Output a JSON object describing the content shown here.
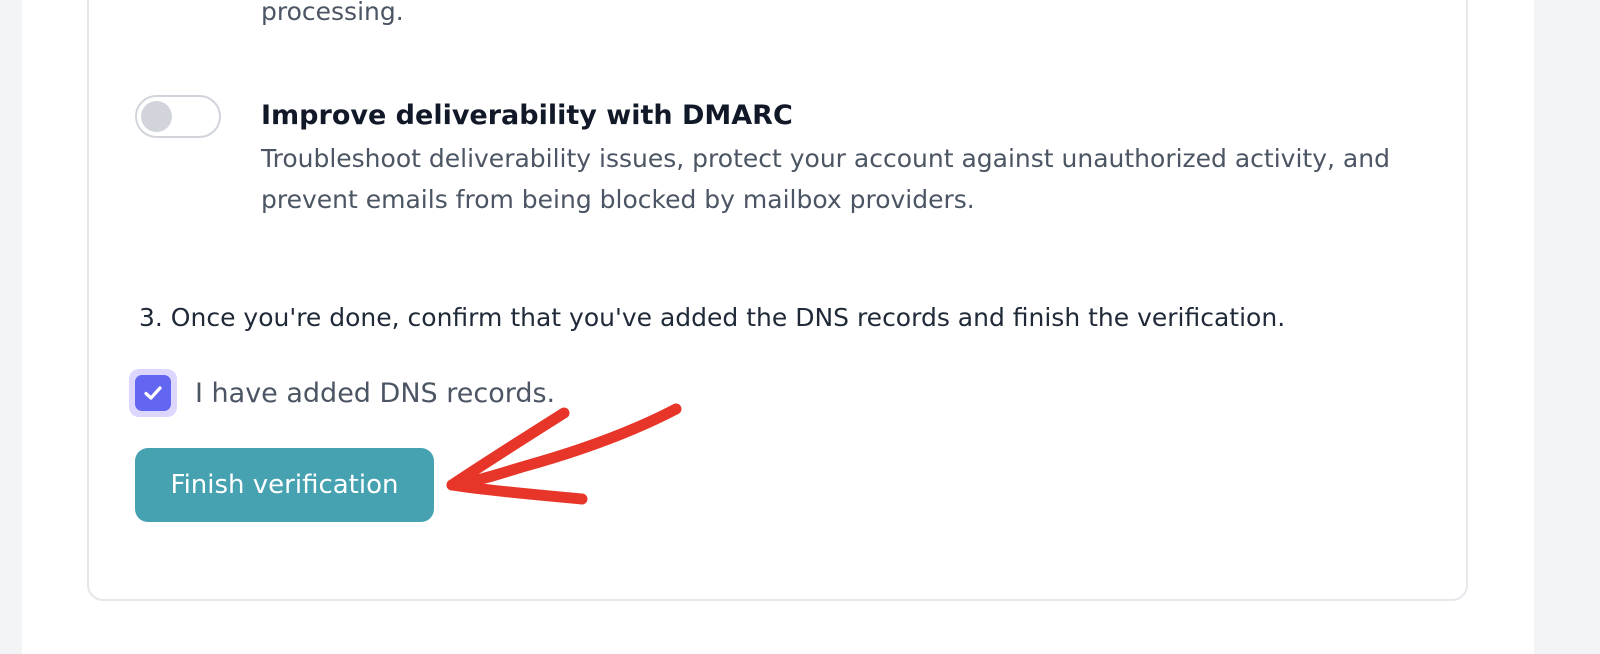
{
  "card": {
    "processing_text": "processing."
  },
  "dmarc": {
    "toggle_on": false,
    "title": "Improve deliverability with DMARC",
    "description": "Troubleshoot deliverability issues, protect your account against unauthorized activity, and prevent emails from being blocked by mailbox providers."
  },
  "step3": {
    "text": "3. Once you're done, confirm that you've added the DNS records and finish the verification."
  },
  "dns_checkbox": {
    "checked": true,
    "label": "I have added DNS records."
  },
  "finish_button": {
    "label": "Finish verification"
  },
  "colors": {
    "checkbox_accent": "#6366f1",
    "button_bg": "#46a2b0",
    "annotation_arrow": "#e8352a"
  },
  "icons": {
    "checkbox": "checkmark-icon",
    "annotation": "red-arrow-icon"
  }
}
